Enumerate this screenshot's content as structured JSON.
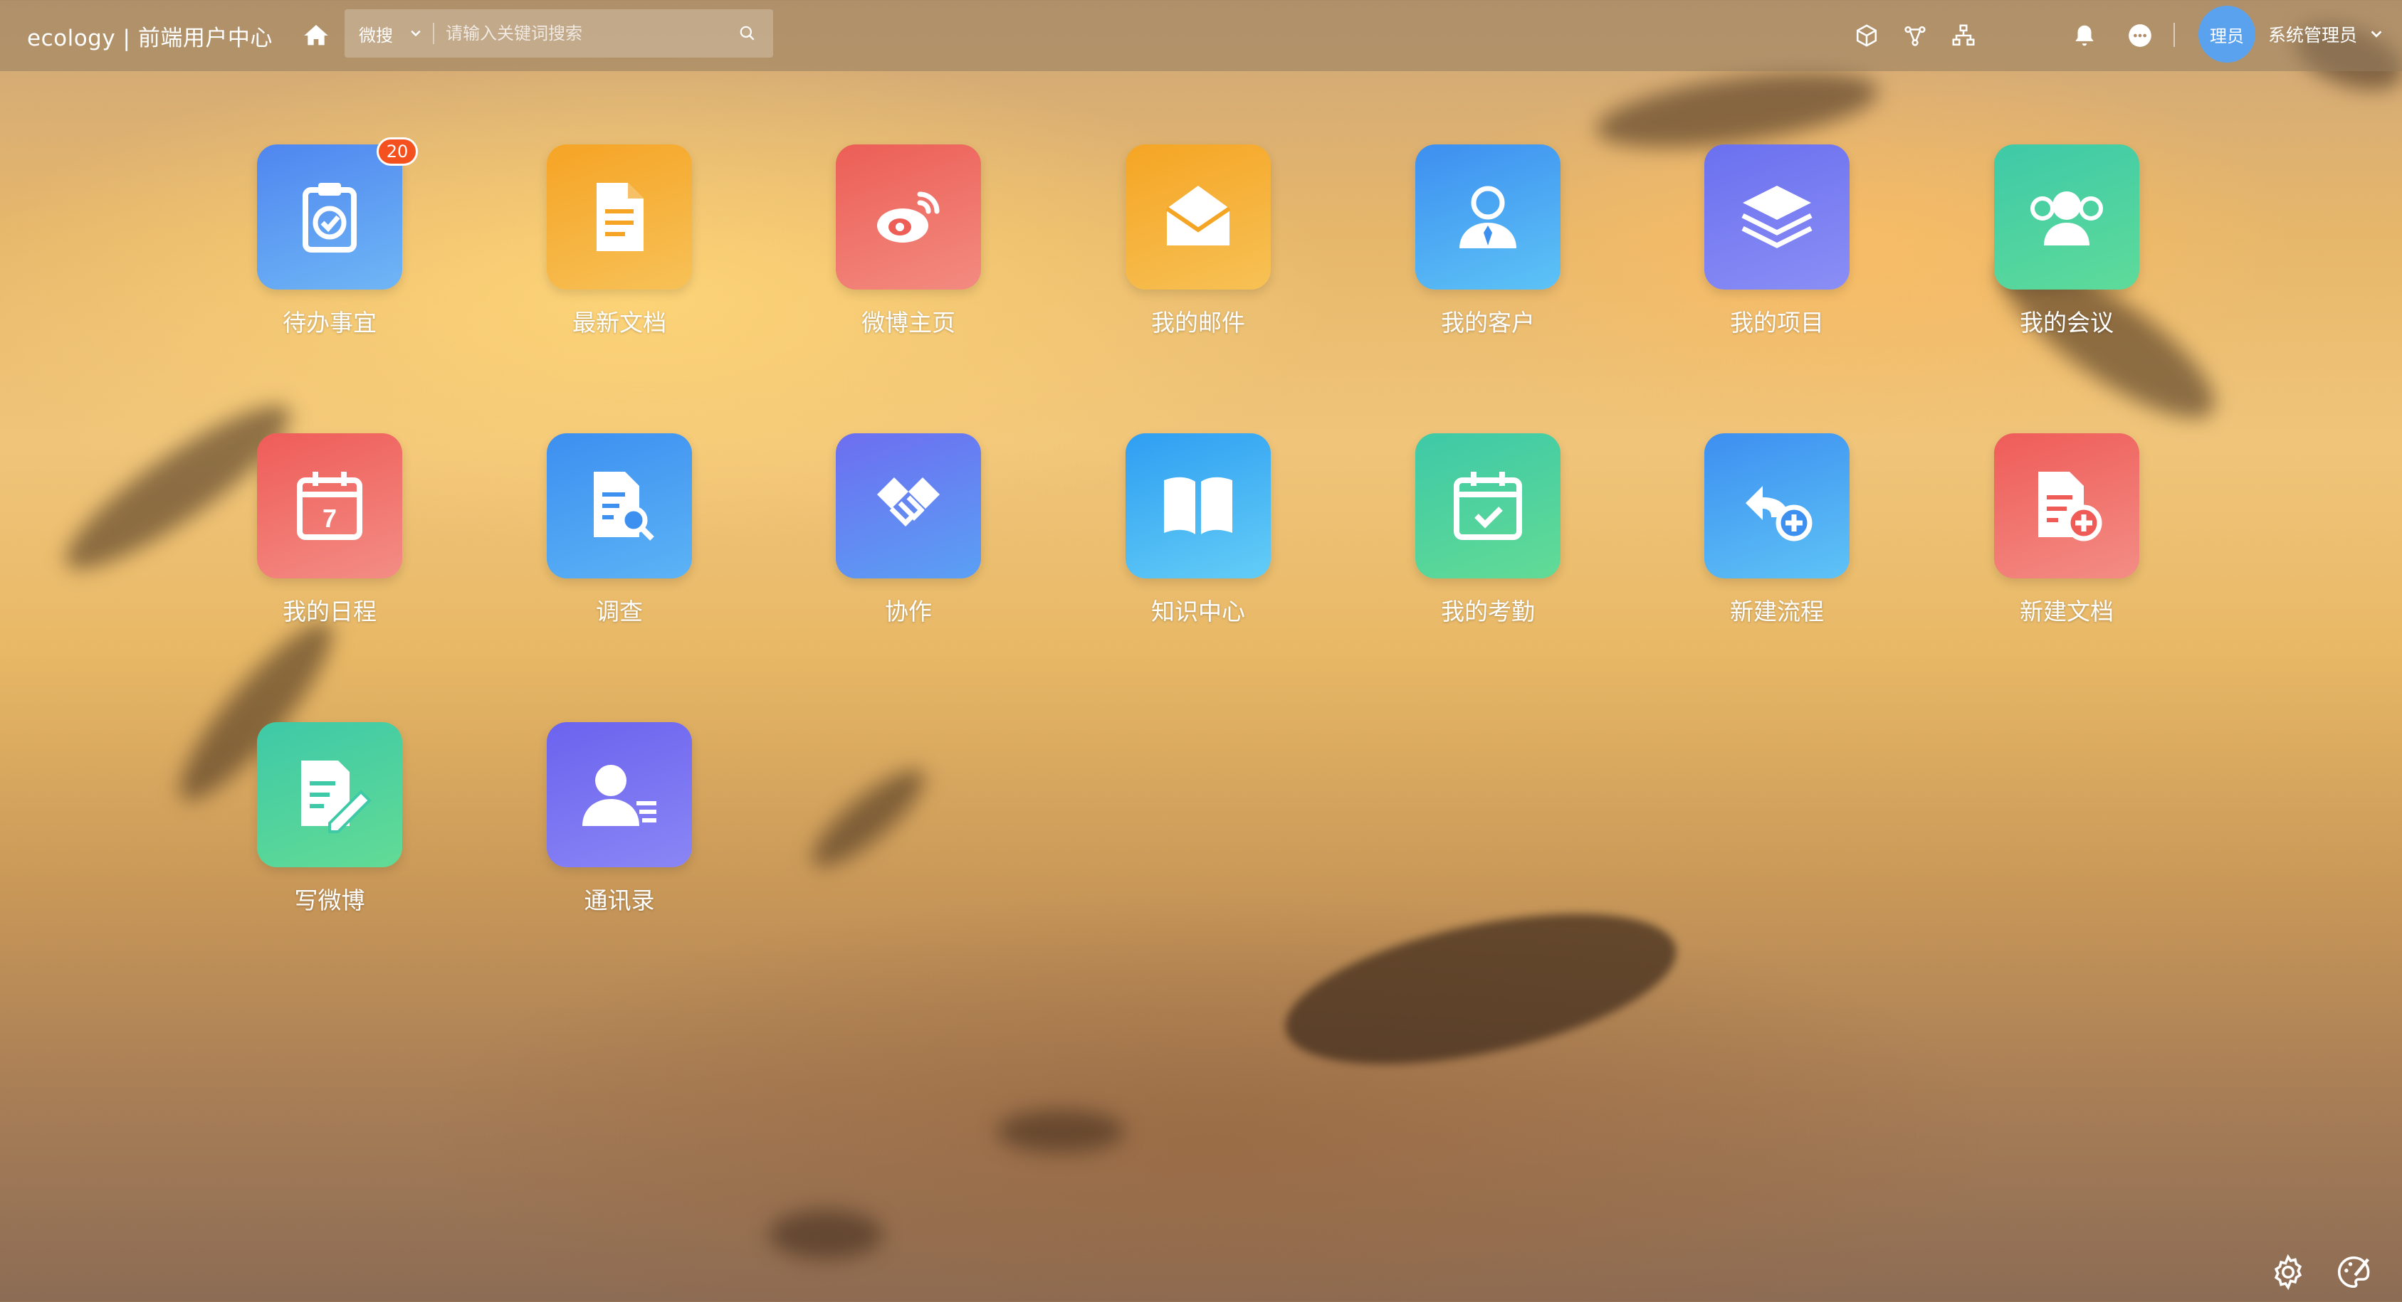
{
  "header": {
    "brand": "ecology | 前端用户中心",
    "search": {
      "scope": "微搜",
      "placeholder": "请输入关键词搜索"
    },
    "user": {
      "avatar_text": "理员",
      "name": "系统管理员"
    },
    "icons": [
      "home-icon",
      "chevron-down-icon",
      "search-icon",
      "cube-icon",
      "diamond-share-icon",
      "org-chart-icon",
      "bell-icon",
      "chat-icon",
      "chevron-down-icon"
    ]
  },
  "apps": [
    {
      "label": "待办事宜",
      "icon": "clipboard-check-icon",
      "badge": "20",
      "colors": [
        "#4f86f0",
        "#6fb6f5"
      ]
    },
    {
      "label": "最新文档",
      "icon": "document-icon",
      "colors": [
        "#f6a425",
        "#f7c157"
      ]
    },
    {
      "label": "微博主页",
      "icon": "weibo-icon",
      "colors": [
        "#ec5e56",
        "#f38b80"
      ]
    },
    {
      "label": "我的邮件",
      "icon": "envelope-icon",
      "colors": [
        "#f5a524",
        "#f7c155"
      ]
    },
    {
      "label": "我的客户",
      "icon": "customer-icon",
      "colors": [
        "#3d8ff0",
        "#5dc3f6"
      ]
    },
    {
      "label": "我的项目",
      "icon": "layers-icon",
      "colors": [
        "#6b70ef",
        "#8a8ef5"
      ]
    },
    {
      "label": "我的会议",
      "icon": "meeting-icon",
      "colors": [
        "#3ec9a7",
        "#5edb9a"
      ]
    },
    {
      "label": "我的日程",
      "icon": "calendar-icon",
      "colors": [
        "#ef5c58",
        "#f38d85"
      ]
    },
    {
      "label": "调查",
      "icon": "survey-icon",
      "colors": [
        "#3d8ff0",
        "#5cb3f5"
      ]
    },
    {
      "label": "协作",
      "icon": "handshake-icon",
      "colors": [
        "#6d6ef0",
        "#5aa0f4"
      ]
    },
    {
      "label": "知识中心",
      "icon": "book-icon",
      "colors": [
        "#2f9ef2",
        "#63cdf6"
      ]
    },
    {
      "label": "我的考勤",
      "icon": "attendance-icon",
      "colors": [
        "#3ec9a7",
        "#62db95"
      ]
    },
    {
      "label": "新建流程",
      "icon": "new-workflow-icon",
      "colors": [
        "#3d8ff0",
        "#5ec3f6"
      ]
    },
    {
      "label": "新建文档",
      "icon": "new-document-icon",
      "colors": [
        "#ef5c58",
        "#f38d85"
      ]
    },
    {
      "label": "写微博",
      "icon": "write-weibo-icon",
      "colors": [
        "#3ec9a7",
        "#62db95"
      ]
    },
    {
      "label": "通讯录",
      "icon": "contacts-icon",
      "colors": [
        "#6b63ee",
        "#8a86f5"
      ]
    }
  ],
  "footer": {
    "icons": [
      "settings-icon",
      "theme-icon"
    ]
  }
}
